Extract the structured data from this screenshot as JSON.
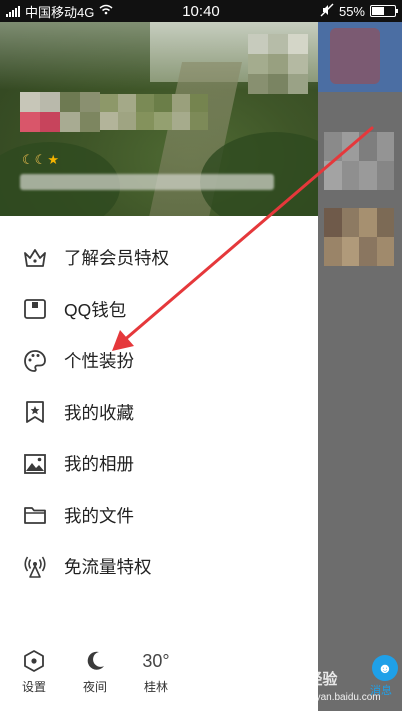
{
  "status_bar": {
    "carrier": "中国移动4G",
    "time": "10:40",
    "battery": "55%",
    "battery_level": 0.55
  },
  "menu": {
    "items": [
      {
        "label": "了解会员特权",
        "icon": "crown-icon"
      },
      {
        "label": "QQ钱包",
        "icon": "wallet-icon"
      },
      {
        "label": "个性装扮",
        "icon": "palette-icon"
      },
      {
        "label": "我的收藏",
        "icon": "bookmark-star-icon"
      },
      {
        "label": "我的相册",
        "icon": "photo-album-icon"
      },
      {
        "label": "我的文件",
        "icon": "folder-icon"
      },
      {
        "label": "免流量特权",
        "icon": "antenna-icon"
      }
    ]
  },
  "bottom_bar": {
    "settings": "设置",
    "night": "夜间",
    "temperature": "30°",
    "city": "桂林"
  },
  "right_panel": {
    "message_label": "消息"
  },
  "watermark": {
    "brand": "Bai经验",
    "url": "jingyan.baidu.com"
  },
  "colors": {
    "accent": "#1fa0e8",
    "arrow": "#e5383b",
    "icon": "#3a3a3a"
  }
}
